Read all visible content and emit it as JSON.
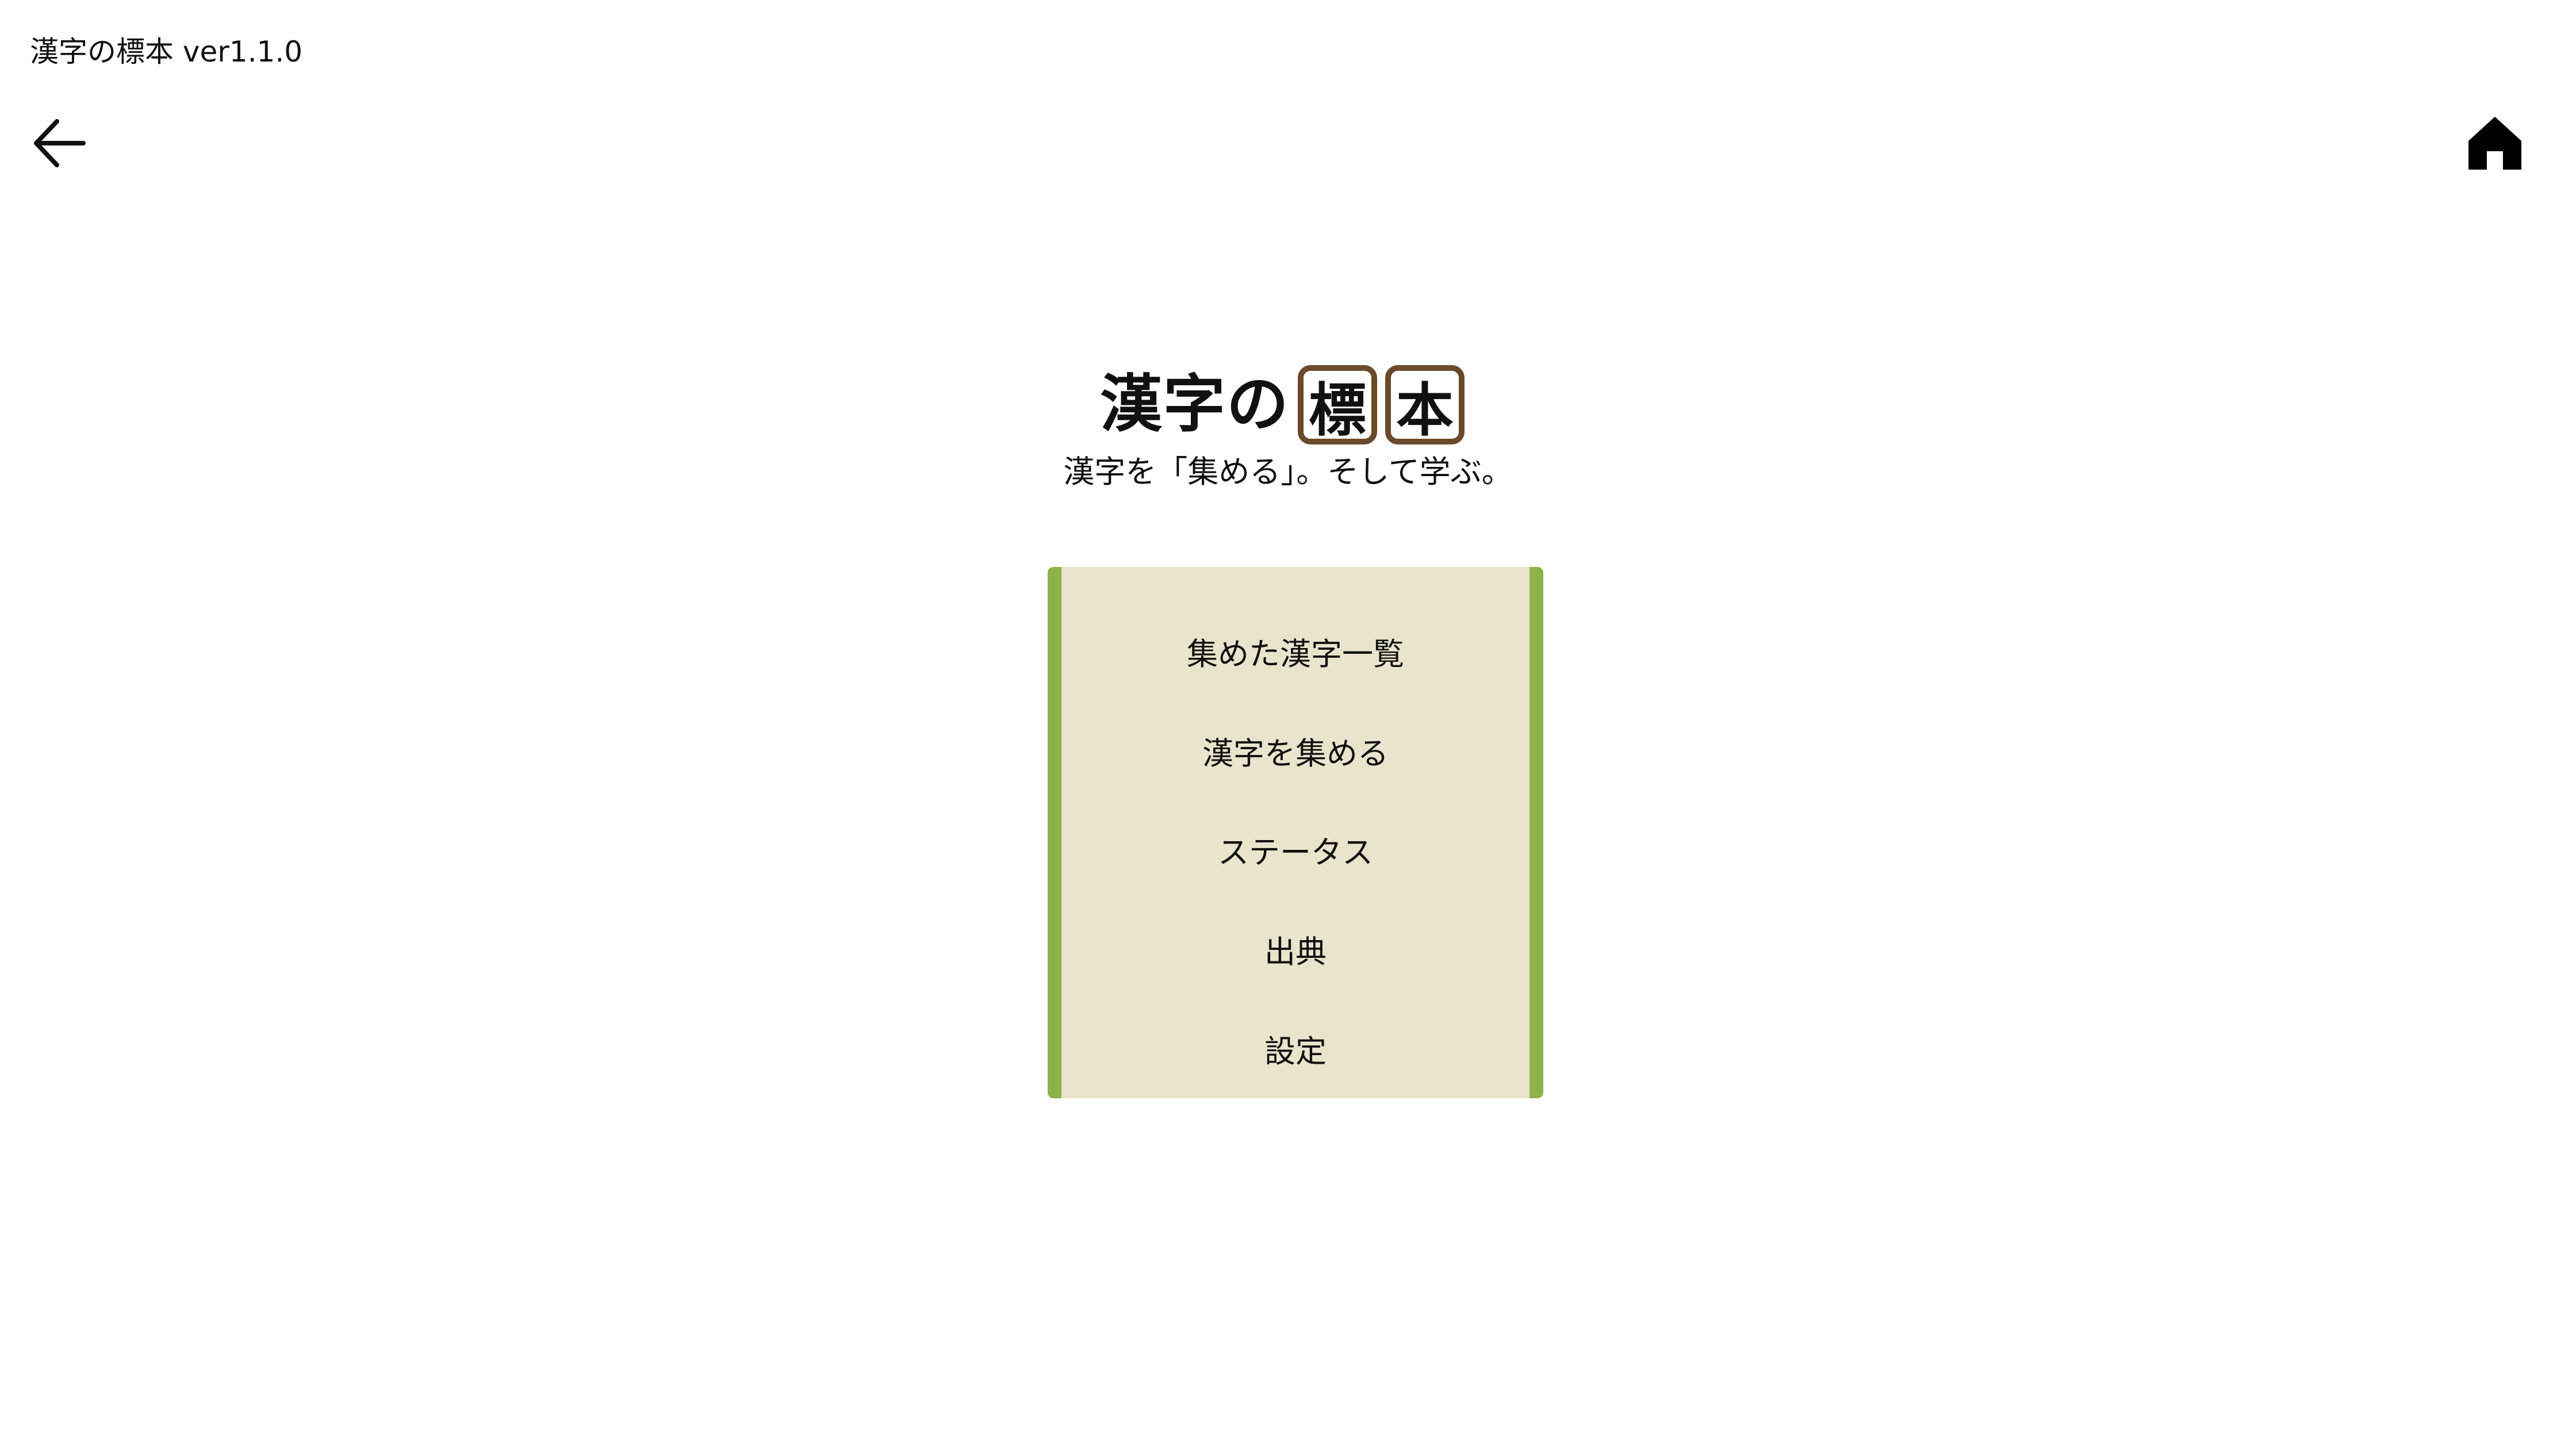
{
  "header": {
    "app_version": "漢字の標本 ver1.1.0",
    "back_icon": "arrow-left-icon",
    "home_icon": "home-icon"
  },
  "logo": {
    "plain_text": "漢字の",
    "boxed_chars": [
      "標",
      "本"
    ]
  },
  "tagline": "漢字を「集める」。そして学ぶ。",
  "menu": {
    "items": [
      {
        "label": "集めた漢字一覧"
      },
      {
        "label": "漢字を集める"
      },
      {
        "label": "ステータス"
      },
      {
        "label": "出典"
      },
      {
        "label": "設定"
      }
    ]
  },
  "colors": {
    "panel_background": "#e8e5cc",
    "panel_border": "#8db24a",
    "logo_box_border": "#6b4a2b"
  }
}
